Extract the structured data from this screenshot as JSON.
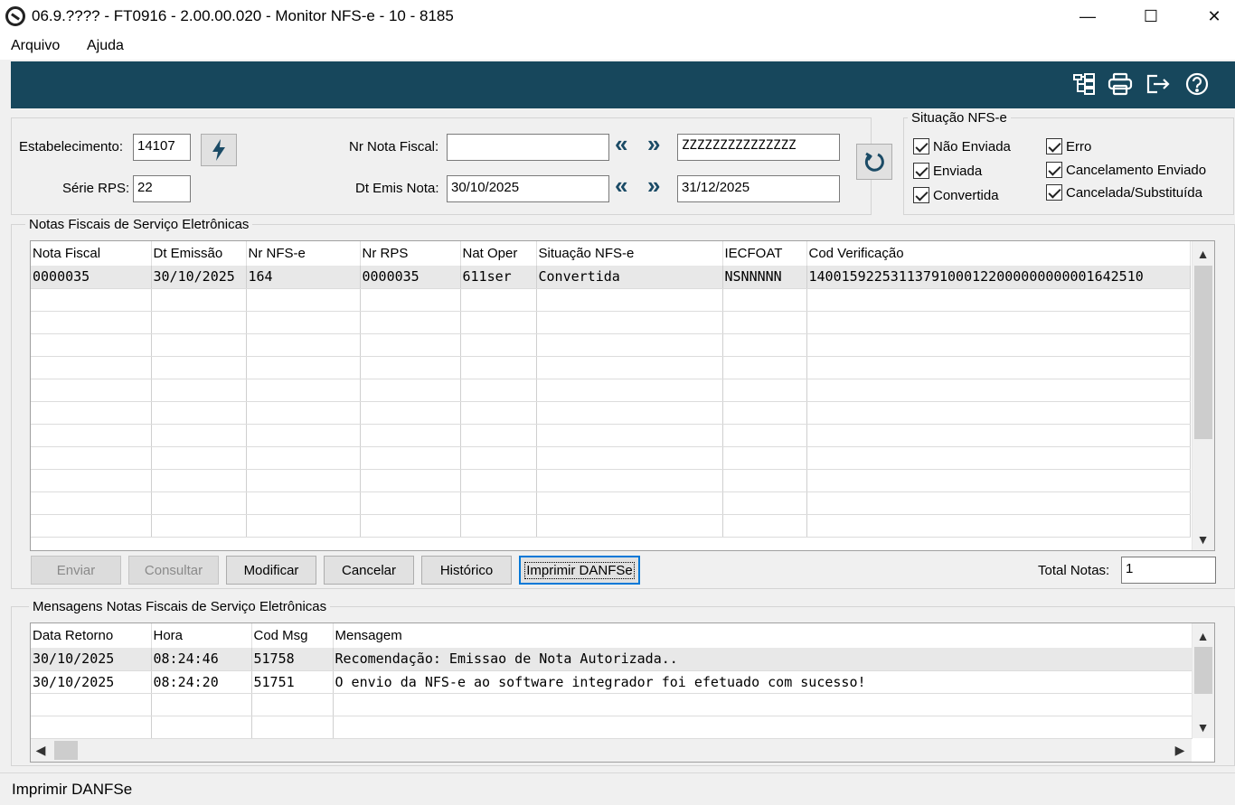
{
  "window": {
    "title": "06.9.???? - FT0916 - 2.00.00.020 - Monitor NFS-e - 10 - 8185",
    "minimize": "—",
    "maximize": "☐",
    "close": "✕"
  },
  "menu": {
    "file": "Arquivo",
    "help": "Ajuda"
  },
  "toolbar": {
    "icons": [
      "tree-structure-icon",
      "printer-icon",
      "exit-icon",
      "help-icon"
    ],
    "color": "#17475c"
  },
  "filters": {
    "estabelecimento_label": "Estabelecimento:",
    "estabelecimento_value": "14107",
    "serie_label": "Série RPS:",
    "serie_value": "22",
    "nr_nota_label": "Nr Nota Fiscal:",
    "nr_nota_from": "",
    "nr_nota_to": "ZZZZZZZZZZZZZZZ",
    "dt_emis_label": "Dt Emis Nota:",
    "dt_emis_from": "30/10/2025",
    "dt_emis_to": "31/12/2025",
    "prev_glyph": "«",
    "next_glyph": "»"
  },
  "situacao": {
    "title": "Situação NFS-e",
    "nao_enviada": "Não Enviada",
    "enviada": "Enviada",
    "convertida": "Convertida",
    "erro": "Erro",
    "cancelamento_enviado": "Cancelamento Enviado",
    "cancelada": "Cancelada/Substituída"
  },
  "notas": {
    "title": "Notas Fiscais de Serviço Eletrônicas",
    "columns": [
      "Nota Fiscal",
      "Dt Emissão",
      "Nr NFS-e",
      "Nr RPS",
      "Nat Oper",
      "Situação NFS-e",
      "IECFOAT",
      "Cod Verificação"
    ],
    "rows": [
      [
        "0000035",
        "30/10/2025",
        "164",
        "0000035",
        "611ser",
        "Convertida",
        "NSNNNNN",
        "14001592253113791000122000000000001642510"
      ]
    ]
  },
  "buttons": {
    "enviar": "Enviar",
    "consultar": "Consultar",
    "modificar": "Modificar",
    "cancelar": "Cancelar",
    "historico": "Histórico",
    "imprimir": "Imprimir DANFSe"
  },
  "total": {
    "label": "Total Notas:",
    "value": "1"
  },
  "mensagens": {
    "title": "Mensagens Notas Fiscais de Serviço Eletrônicas",
    "columns": [
      "Data Retorno",
      "Hora",
      "Cod Msg",
      "Mensagem"
    ],
    "rows": [
      [
        "30/10/2025",
        "08:24:46",
        "51758",
        "Recomendação: Emissao de Nota Autorizada.."
      ],
      [
        "30/10/2025",
        "08:24:20",
        "51751",
        "O envio da NFS-e ao software integrador foi efetuado com sucesso!"
      ]
    ]
  },
  "status": {
    "text": "Imprimir DANFSe"
  }
}
